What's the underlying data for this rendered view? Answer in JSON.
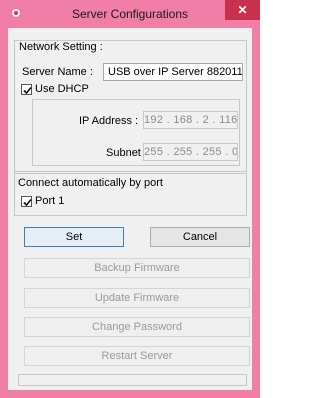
{
  "window": {
    "title": "Server Configurations",
    "close_glyph": "✕",
    "accent_color": "#f07ea6",
    "app_icon": "usb-server-app-icon"
  },
  "network": {
    "group_label": "Network Setting :",
    "server_name_label": "Server Name :",
    "server_name_value": "USB over IP Server 882011",
    "dhcp_label": "Use DHCP",
    "dhcp_checked": true,
    "ip_label": "IP Address :",
    "ip_value": "192 . 168 . 2 . 116",
    "subnet_label": "Subnet :",
    "subnet_value": "255 . 255 . 255 . 0"
  },
  "connect": {
    "group_label": "Connect automatically by port",
    "port1_label": "Port 1",
    "port1_checked": true
  },
  "buttons": {
    "set": "Set",
    "cancel": "Cancel",
    "backup": "Backup Firmware",
    "update": "Update Firmware",
    "change_password": "Change Password",
    "restart": "Restart Server"
  }
}
